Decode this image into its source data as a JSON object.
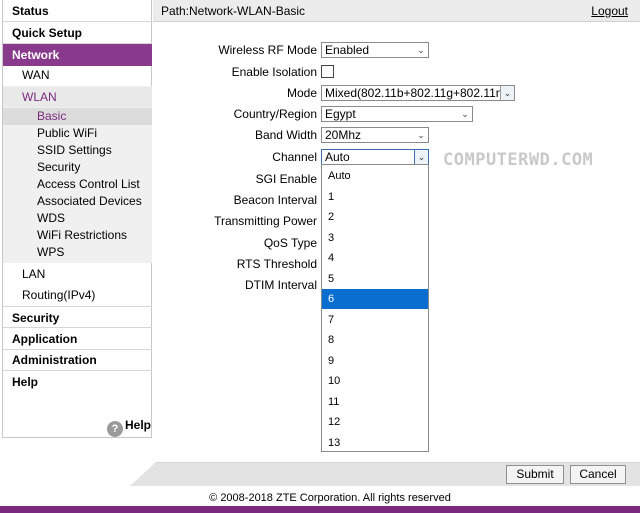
{
  "header": {
    "path": "Path:Network-WLAN-Basic",
    "logout_label": "Logout"
  },
  "sidebar": {
    "main_items": [
      "Status",
      "Quick Setup",
      "Network",
      "Security",
      "Application",
      "Administration",
      "Help"
    ],
    "network_subitems": [
      "WAN",
      "WLAN",
      "LAN",
      "Routing(IPv4)"
    ],
    "wlan_leaves": [
      "Basic",
      "Public WiFi",
      "SSID Settings",
      "Security",
      "Access Control List",
      "Associated Devices",
      "WDS",
      "WiFi Restrictions",
      "WPS"
    ],
    "active_main": "Network",
    "active_sub": "WLAN",
    "active_leaf": "Basic",
    "help_label": "Help",
    "help_icon": "question-circle-icon"
  },
  "form": {
    "wireless_rf_mode": {
      "label": "Wireless RF Mode",
      "value": "Enabled"
    },
    "enable_isolation": {
      "label": "Enable Isolation",
      "checked": false
    },
    "mode": {
      "label": "Mode",
      "value": "Mixed(802.11b+802.11g+802.11n"
    },
    "country_region": {
      "label": "Country/Region",
      "value": "Egypt"
    },
    "band_width": {
      "label": "Band Width",
      "value": "20Mhz"
    },
    "channel": {
      "label": "Channel",
      "value": "Auto"
    },
    "sgi_enable": {
      "label": "SGI Enable"
    },
    "beacon_interval": {
      "label": "Beacon Interval"
    },
    "transmitting_power": {
      "label": "Transmitting Power"
    },
    "qos_type": {
      "label": "QoS Type"
    },
    "rts_threshold": {
      "label": "RTS Threshold"
    },
    "dtim_interval": {
      "label": "DTIM Interval"
    }
  },
  "channel_dropdown": {
    "options": [
      "Auto",
      "1",
      "2",
      "3",
      "4",
      "5",
      "6",
      "7",
      "8",
      "9",
      "10",
      "11",
      "12",
      "13"
    ],
    "highlighted": "6",
    "highlight_color": "#0a6ed1"
  },
  "watermark": "COMPUTERWD.COM",
  "footer": {
    "submit_label": "Submit",
    "cancel_label": "Cancel",
    "copyright": "© 2008-2018 ZTE Corporation. All rights reserved"
  },
  "colors": {
    "accent": "#8a3a8c",
    "selection": "#0a6ed1"
  }
}
